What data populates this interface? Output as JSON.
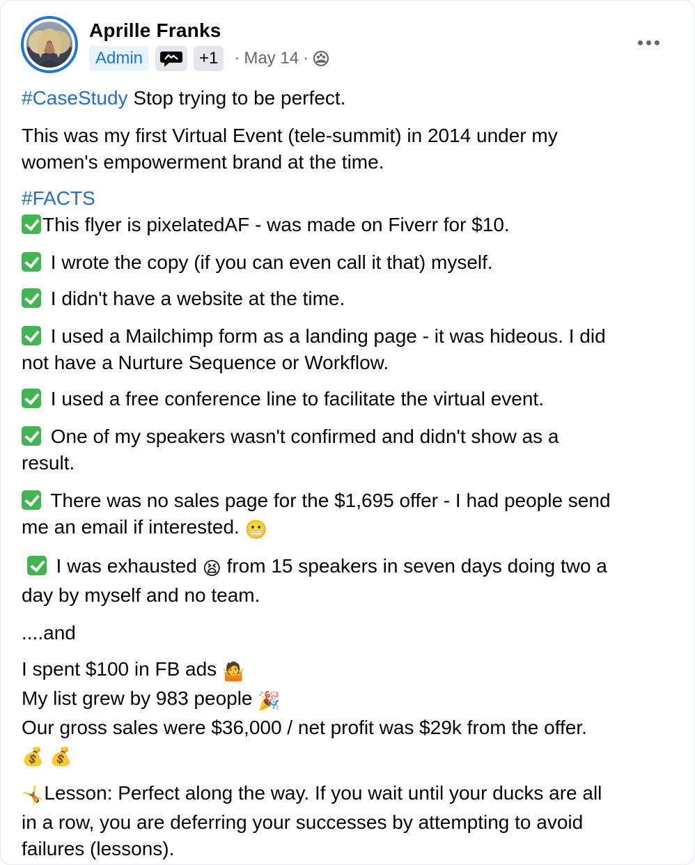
{
  "author": {
    "name": "Aprille Franks",
    "badge_admin": "Admin",
    "badge_plus": "+1",
    "date": "May 14",
    "sep": "·"
  },
  "post": {
    "hashtag_case": "#CaseStudy",
    "line_intro": " Stop trying to be perfect.",
    "para_event_1": "This was my first Virtual Event (tele-summit) in 2014 under my",
    "para_event_2": "women's empowerment brand at the time.",
    "hashtag_facts": "#FACTS",
    "facts": [
      "This flyer is pixelatedAF - was made on Fiverr for $10.",
      " I wrote the copy (if you can even call it that) myself.",
      " I didn't have a website at the time.",
      " I used a Mailchimp form as a landing page - it was hideous. I did",
      "not have a Nurture Sequence or Workflow.",
      " I used a free conference line to facilitate the virtual event.",
      " One of my speakers wasn't confirmed and didn't show as a",
      "result.",
      " There was no sales page for the $1,695 offer - I had people send",
      "me an email if interested. ",
      " I was exhausted ",
      " from 15 speakers in seven days doing two a",
      "day by myself and no team."
    ],
    "and_line": "....and",
    "result_1": "I spent $100 in FB ads ",
    "result_2": "My list grew by 983 people ",
    "result_3": "Our gross sales were $36,000 / net profit was $29k from the offer.",
    "lesson_1": "Lesson: Perfect along the way. If you wait until your ducks are all",
    "lesson_2": "in a row, you are deferring your successes by attempting to avoid",
    "lesson_3": "failures (lessons).",
    "emoji": {
      "grimace": "😬",
      "tired": "😫",
      "shrug": "🤷",
      "party": "🎉",
      "moneybag": "💰",
      "cartwheel": "🤸"
    }
  },
  "icons": {
    "more": "more-options-icon",
    "privacy": "group-audience-icon",
    "chat_badge": "conversation-badge-icon"
  },
  "colors": {
    "link": "#216fdb",
    "admin_bg": "#e7f3ff",
    "admin_text": "#1b74e4",
    "check": "#3fb650",
    "meta": "#65676b"
  }
}
